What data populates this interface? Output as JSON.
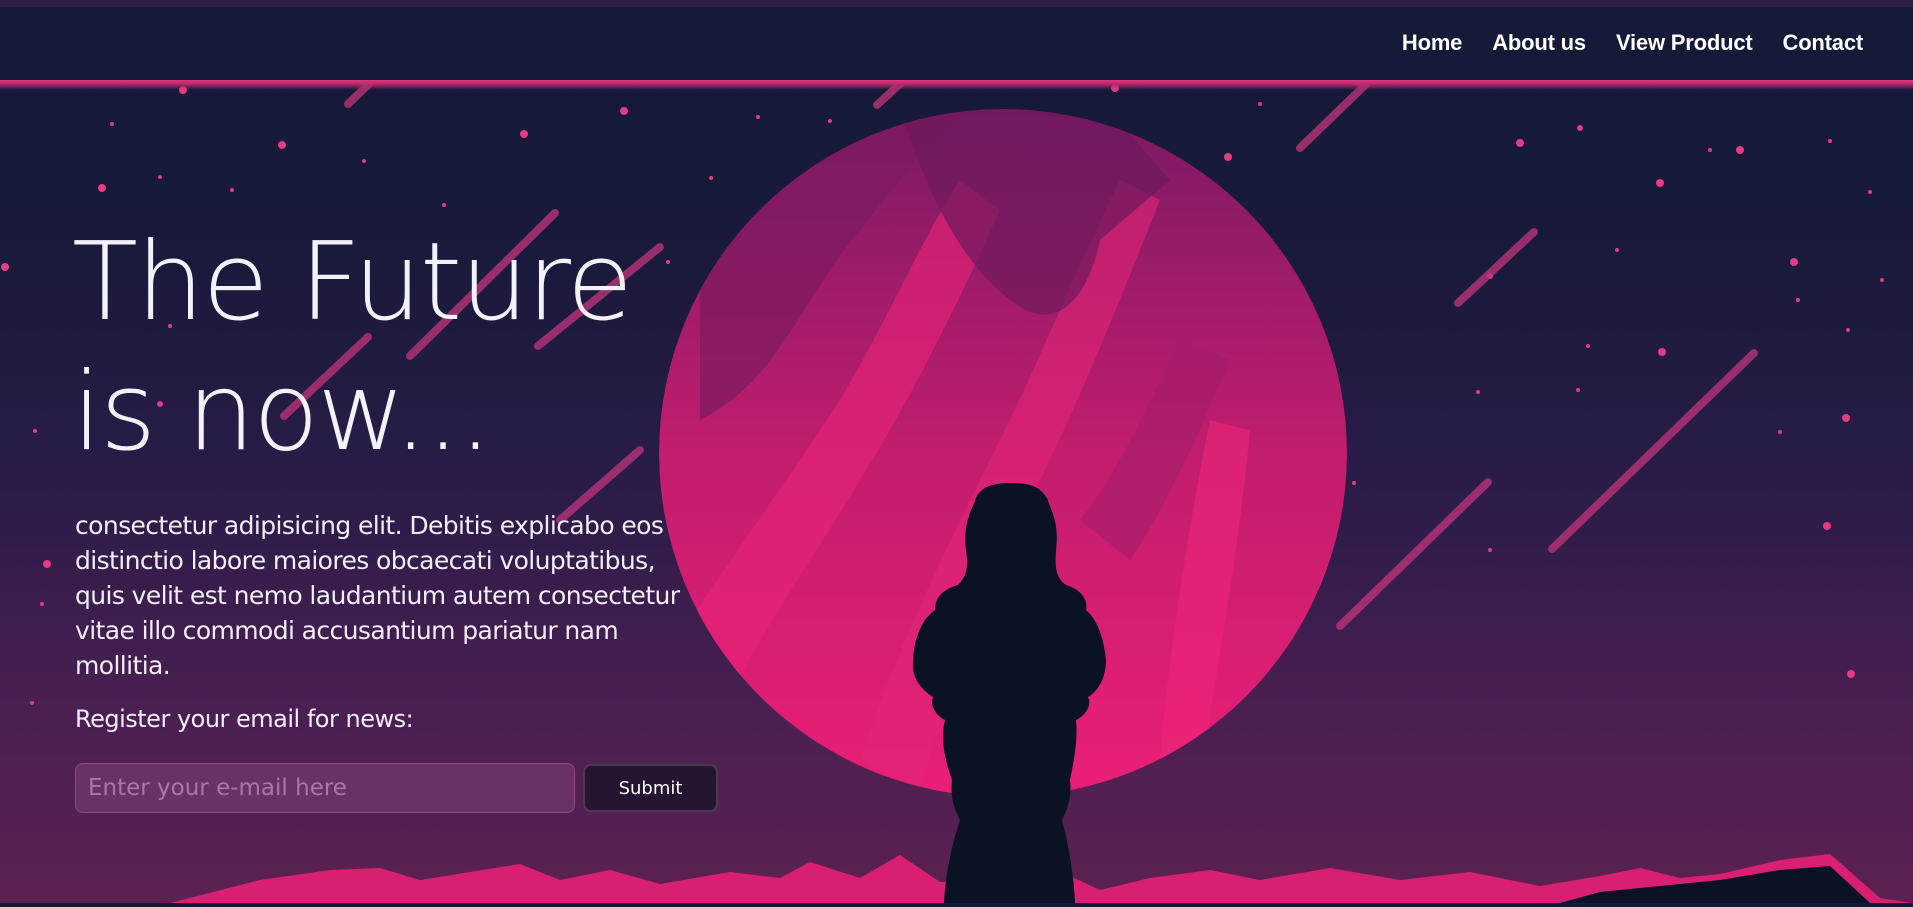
{
  "nav": {
    "items": [
      "Home",
      "About us",
      "View Product",
      "Contact"
    ]
  },
  "hero": {
    "title_line1": "The Future",
    "title_line2": "is now...",
    "body": "consectetur adipisicing elit. Debitis explicabo eos distinctio labore maiores obcaecati voluptatibus, quis velit est nemo laudantium autem consectetur vitae illo commodi accusantium pariatur nam mollitia.",
    "register_label": "Register your email for news:",
    "email_placeholder": "Enter your e-mail here",
    "submit_label": "Submit"
  },
  "colors": {
    "nav_bg": "#141a38",
    "accent": "#e91e78",
    "planet": "#d61f72",
    "silhouette": "#0a1224",
    "button_bg": "#241530",
    "input_bg": "#6a3164"
  }
}
